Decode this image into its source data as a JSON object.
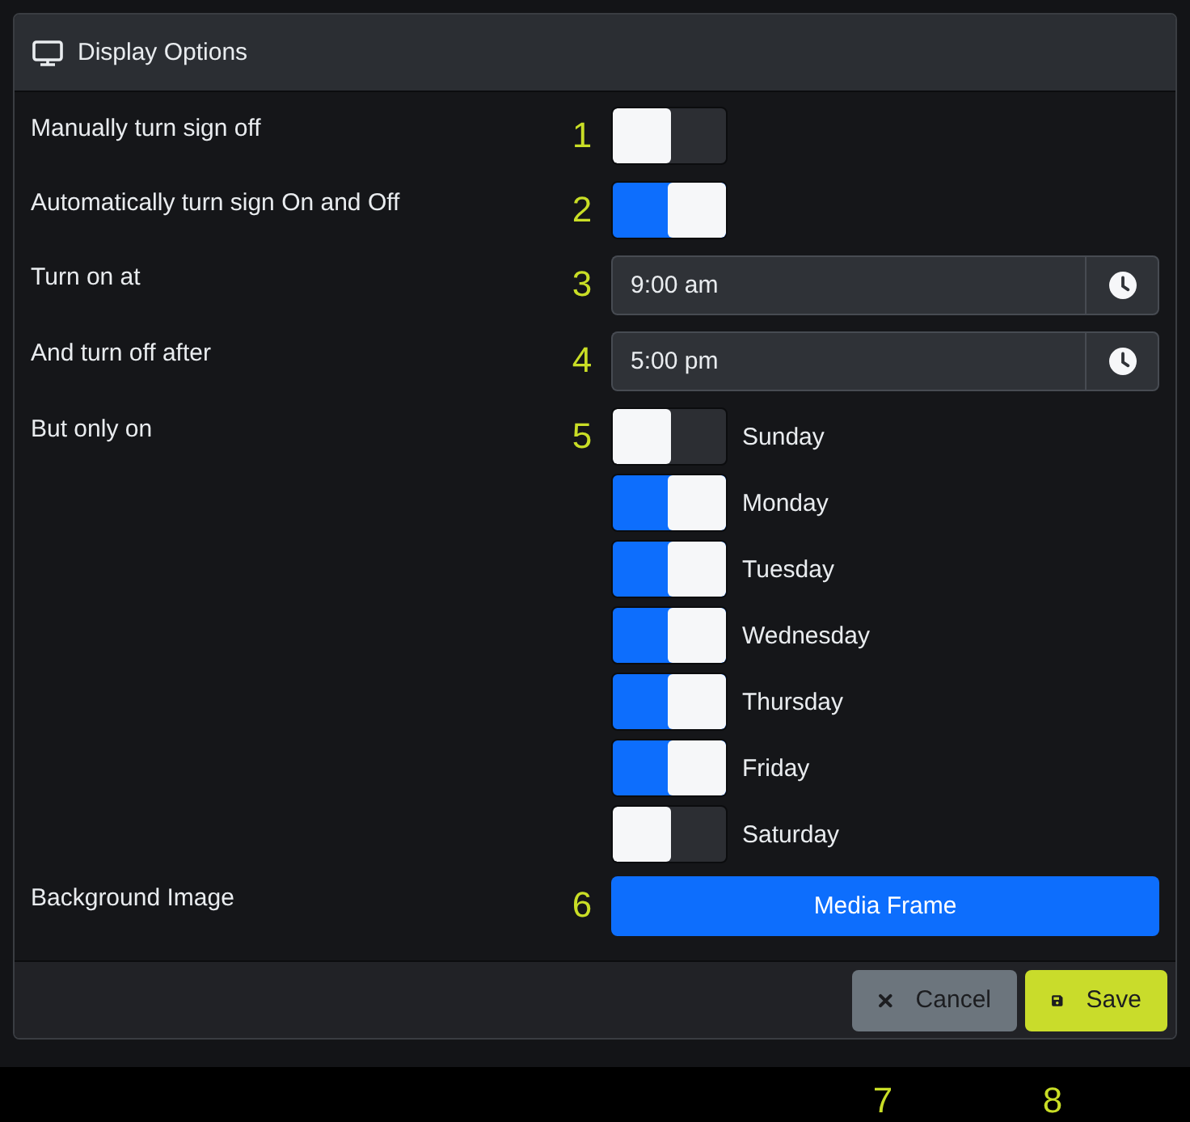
{
  "header": {
    "title": "Display Options"
  },
  "settings": [
    {
      "kind": "toggle",
      "label": "Manually turn sign off",
      "callout": "1",
      "on": false
    },
    {
      "kind": "toggle",
      "label": "Automatically turn sign On and Off",
      "callout": "2",
      "on": true
    },
    {
      "kind": "time",
      "label": "Turn on at",
      "callout": "3",
      "value": "9:00 am"
    },
    {
      "kind": "time",
      "label": "And turn off after",
      "callout": "4",
      "value": "5:00 pm"
    },
    {
      "kind": "days",
      "label": "But only on",
      "callout": "5",
      "days": [
        {
          "name": "Sunday",
          "on": false
        },
        {
          "name": "Monday",
          "on": true
        },
        {
          "name": "Tuesday",
          "on": true
        },
        {
          "name": "Wednesday",
          "on": true
        },
        {
          "name": "Thursday",
          "on": true
        },
        {
          "name": "Friday",
          "on": true
        },
        {
          "name": "Saturday",
          "on": false
        }
      ]
    },
    {
      "kind": "button",
      "label": "Background Image",
      "callout": "6",
      "button": "Media Frame"
    }
  ],
  "footer": {
    "buttons": [
      {
        "kind": "cancel",
        "label": "Cancel",
        "callout": "7"
      },
      {
        "kind": "save",
        "label": "Save",
        "callout": "8"
      }
    ]
  }
}
